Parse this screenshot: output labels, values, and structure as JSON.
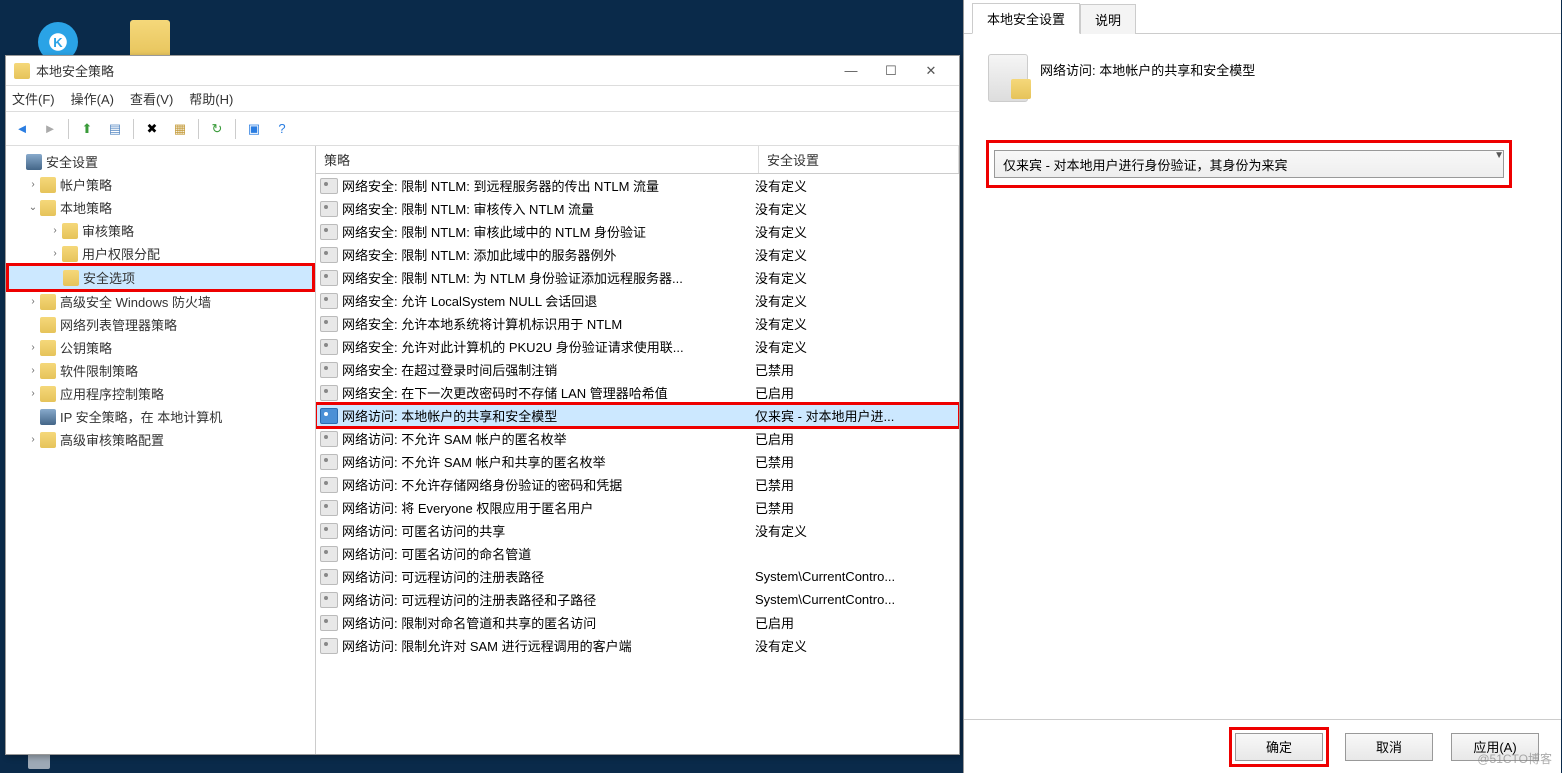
{
  "desktop": {
    "app_icon_letter": "K"
  },
  "mmc": {
    "title": "本地安全策略",
    "menu": {
      "file": "文件(F)",
      "action": "操作(A)",
      "view": "查看(V)",
      "help": "帮助(H)"
    },
    "tree": {
      "root": "安全设置",
      "items": [
        {
          "label": "帐户策略",
          "indent": 1,
          "exp": "›"
        },
        {
          "label": "本地策略",
          "indent": 1,
          "exp": "⌄"
        },
        {
          "label": "审核策略",
          "indent": 2,
          "exp": "›"
        },
        {
          "label": "用户权限分配",
          "indent": 2,
          "exp": "›"
        },
        {
          "label": "安全选项",
          "indent": 2,
          "exp": "",
          "selected": true,
          "redbox": true
        },
        {
          "label": "高级安全 Windows 防火墙",
          "indent": 1,
          "exp": "›"
        },
        {
          "label": "网络列表管理器策略",
          "indent": 1,
          "exp": ""
        },
        {
          "label": "公钥策略",
          "indent": 1,
          "exp": "›"
        },
        {
          "label": "软件限制策略",
          "indent": 1,
          "exp": "›"
        },
        {
          "label": "应用程序控制策略",
          "indent": 1,
          "exp": "›"
        },
        {
          "label": "IP 安全策略，在 本地计算机",
          "indent": 1,
          "exp": "",
          "special": true
        },
        {
          "label": "高级审核策略配置",
          "indent": 1,
          "exp": "›"
        }
      ]
    },
    "listHeader": {
      "policy": "策略",
      "setting": "安全设置"
    },
    "rows": [
      {
        "policy": "网络安全: 限制 NTLM: 到远程服务器的传出 NTLM 流量",
        "setting": "没有定义"
      },
      {
        "policy": "网络安全: 限制 NTLM: 审核传入 NTLM 流量",
        "setting": "没有定义"
      },
      {
        "policy": "网络安全: 限制 NTLM: 审核此域中的 NTLM 身份验证",
        "setting": "没有定义"
      },
      {
        "policy": "网络安全: 限制 NTLM: 添加此域中的服务器例外",
        "setting": "没有定义"
      },
      {
        "policy": "网络安全: 限制 NTLM: 为 NTLM 身份验证添加远程服务器...",
        "setting": "没有定义"
      },
      {
        "policy": "网络安全: 允许 LocalSystem NULL 会话回退",
        "setting": "没有定义"
      },
      {
        "policy": "网络安全: 允许本地系统将计算机标识用于 NTLM",
        "setting": "没有定义"
      },
      {
        "policy": "网络安全: 允许对此计算机的 PKU2U 身份验证请求使用联...",
        "setting": "没有定义"
      },
      {
        "policy": "网络安全: 在超过登录时间后强制注销",
        "setting": "已禁用"
      },
      {
        "policy": "网络安全: 在下一次更改密码时不存储 LAN 管理器哈希值",
        "setting": "已启用"
      },
      {
        "policy": "网络访问: 本地帐户的共享和安全模型",
        "setting": "仅来宾 - 对本地用户进...",
        "selected": true,
        "redbox": true
      },
      {
        "policy": "网络访问: 不允许 SAM 帐户的匿名枚举",
        "setting": "已启用"
      },
      {
        "policy": "网络访问: 不允许 SAM 帐户和共享的匿名枚举",
        "setting": "已禁用"
      },
      {
        "policy": "网络访问: 不允许存储网络身份验证的密码和凭据",
        "setting": "已禁用"
      },
      {
        "policy": "网络访问: 将 Everyone 权限应用于匿名用户",
        "setting": "已禁用"
      },
      {
        "policy": "网络访问: 可匿名访问的共享",
        "setting": "没有定义"
      },
      {
        "policy": "网络访问: 可匿名访问的命名管道",
        "setting": ""
      },
      {
        "policy": "网络访问: 可远程访问的注册表路径",
        "setting": "System\\CurrentContro..."
      },
      {
        "policy": "网络访问: 可远程访问的注册表路径和子路径",
        "setting": "System\\CurrentContro..."
      },
      {
        "policy": "网络访问: 限制对命名管道和共享的匿名访问",
        "setting": "已启用"
      },
      {
        "policy": "网络访问: 限制允许对 SAM 进行远程调用的客户端",
        "setting": "没有定义"
      }
    ]
  },
  "props": {
    "tab_local": "本地安全设置",
    "tab_explain": "说明",
    "policy_name": "网络访问: 本地帐户的共享和安全模型",
    "combo_value": "仅来宾 - 对本地用户进行身份验证，其身份为来宾",
    "ok": "确定",
    "cancel": "取消",
    "apply": "应用(A)"
  },
  "watermark": "@51CTO博客"
}
